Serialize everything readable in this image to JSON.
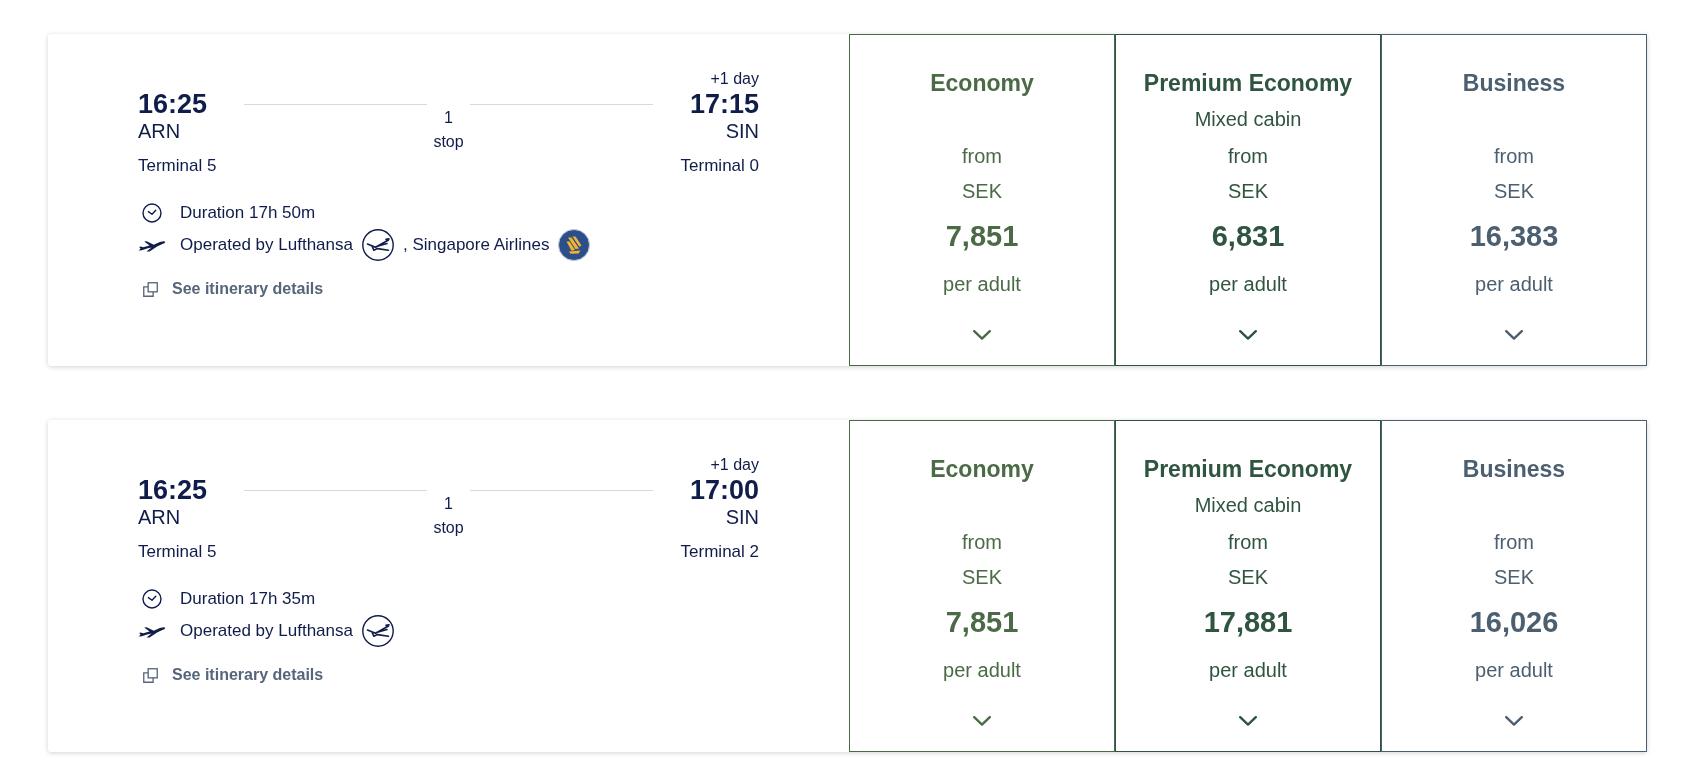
{
  "flights": [
    {
      "departure": {
        "time": "16:25",
        "airport": "ARN",
        "terminal": "Terminal 5"
      },
      "stops": "1 stop",
      "arrival": {
        "day_offset": "+1 day",
        "time": "17:15",
        "airport": "SIN",
        "terminal": "Terminal 0"
      },
      "duration": "Duration 17h 50m",
      "operators": [
        {
          "name": "Operated by Lufthansa",
          "kind": "ring"
        },
        {
          "name": ", Singapore Airlines",
          "kind": "disc"
        }
      ],
      "details_link": "See itinerary details",
      "fares": [
        {
          "cabin": "Economy",
          "from": "from",
          "currency": "SEK",
          "price": "7,851",
          "unit": "per adult",
          "color": "#4b6b46"
        },
        {
          "cabin": "Premium Economy",
          "note": "Mixed cabin",
          "from": "from",
          "currency": "SEK",
          "price": "6,831",
          "unit": "per adult",
          "color": "#2f543f"
        },
        {
          "cabin": "Business",
          "from": "from",
          "currency": "SEK",
          "price": "16,383",
          "unit": "per adult",
          "color": "#4c5f70"
        }
      ]
    },
    {
      "departure": {
        "time": "16:25",
        "airport": "ARN",
        "terminal": "Terminal 5"
      },
      "stops": "1 stop",
      "arrival": {
        "day_offset": "+1 day",
        "time": "17:00",
        "airport": "SIN",
        "terminal": "Terminal 2"
      },
      "duration": "Duration 17h 35m",
      "operators": [
        {
          "name": "Operated by Lufthansa",
          "kind": "ring"
        }
      ],
      "details_link": "See itinerary details",
      "fares": [
        {
          "cabin": "Economy",
          "from": "from",
          "currency": "SEK",
          "price": "7,851",
          "unit": "per adult",
          "color": "#4b6b46"
        },
        {
          "cabin": "Premium Economy",
          "note": "Mixed cabin",
          "from": "from",
          "currency": "SEK",
          "price": "17,881",
          "unit": "per adult",
          "color": "#2f543f"
        },
        {
          "cabin": "Business",
          "from": "from",
          "currency": "SEK",
          "price": "16,026",
          "unit": "per adult",
          "color": "#4c5f70"
        }
      ]
    }
  ]
}
